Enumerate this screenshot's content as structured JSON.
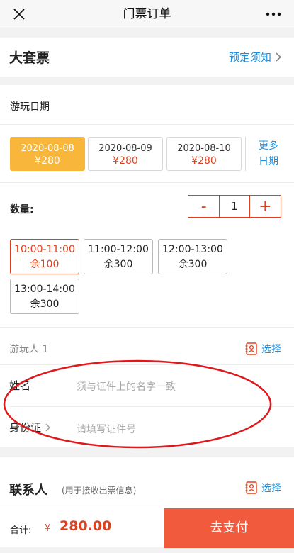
{
  "topbar": {
    "title": "门票订单"
  },
  "ticket": {
    "name": "大套票",
    "notice_label": "预定须知"
  },
  "booking": {
    "date_label": "游玩日期",
    "dates": [
      {
        "date": "2020-08-08",
        "price": "¥280",
        "selected": true
      },
      {
        "date": "2020-08-09",
        "price": "¥280",
        "selected": false
      },
      {
        "date": "2020-08-10",
        "price": "¥280",
        "selected": false
      }
    ],
    "more_dates_line1": "更多",
    "more_dates_line2": "日期",
    "quantity_label": "数量:",
    "quantity_minus": "-",
    "quantity_value": "1",
    "quantity_plus": "+",
    "slots": [
      {
        "time": "10:00-11:00",
        "remain": "余100",
        "selected": true
      },
      {
        "time": "11:00-12:00",
        "remain": "余300",
        "selected": false
      },
      {
        "time": "12:00-13:00",
        "remain": "余300",
        "selected": false
      },
      {
        "time": "13:00-14:00",
        "remain": "余300",
        "selected": false
      }
    ],
    "traveler_label": "游玩人 1",
    "choose_label": "选择",
    "name_label": "姓名",
    "name_placeholder": "须与证件上的名字一致",
    "id_label": "身份证",
    "id_placeholder": "请填写证件号"
  },
  "contact": {
    "title": "联系人",
    "subtitle": "(用于接收出票信息)",
    "choose_label": "选择"
  },
  "footer": {
    "total_label": "合计:",
    "currency": "¥",
    "amount": "280.00",
    "pay_label": "去支付"
  },
  "colors": {
    "accent": "#1a8fe0",
    "price": "#e0401d",
    "selected_date": "#f8b73b",
    "pay_button": "#f25a3e",
    "annotation": "#e0171b"
  }
}
